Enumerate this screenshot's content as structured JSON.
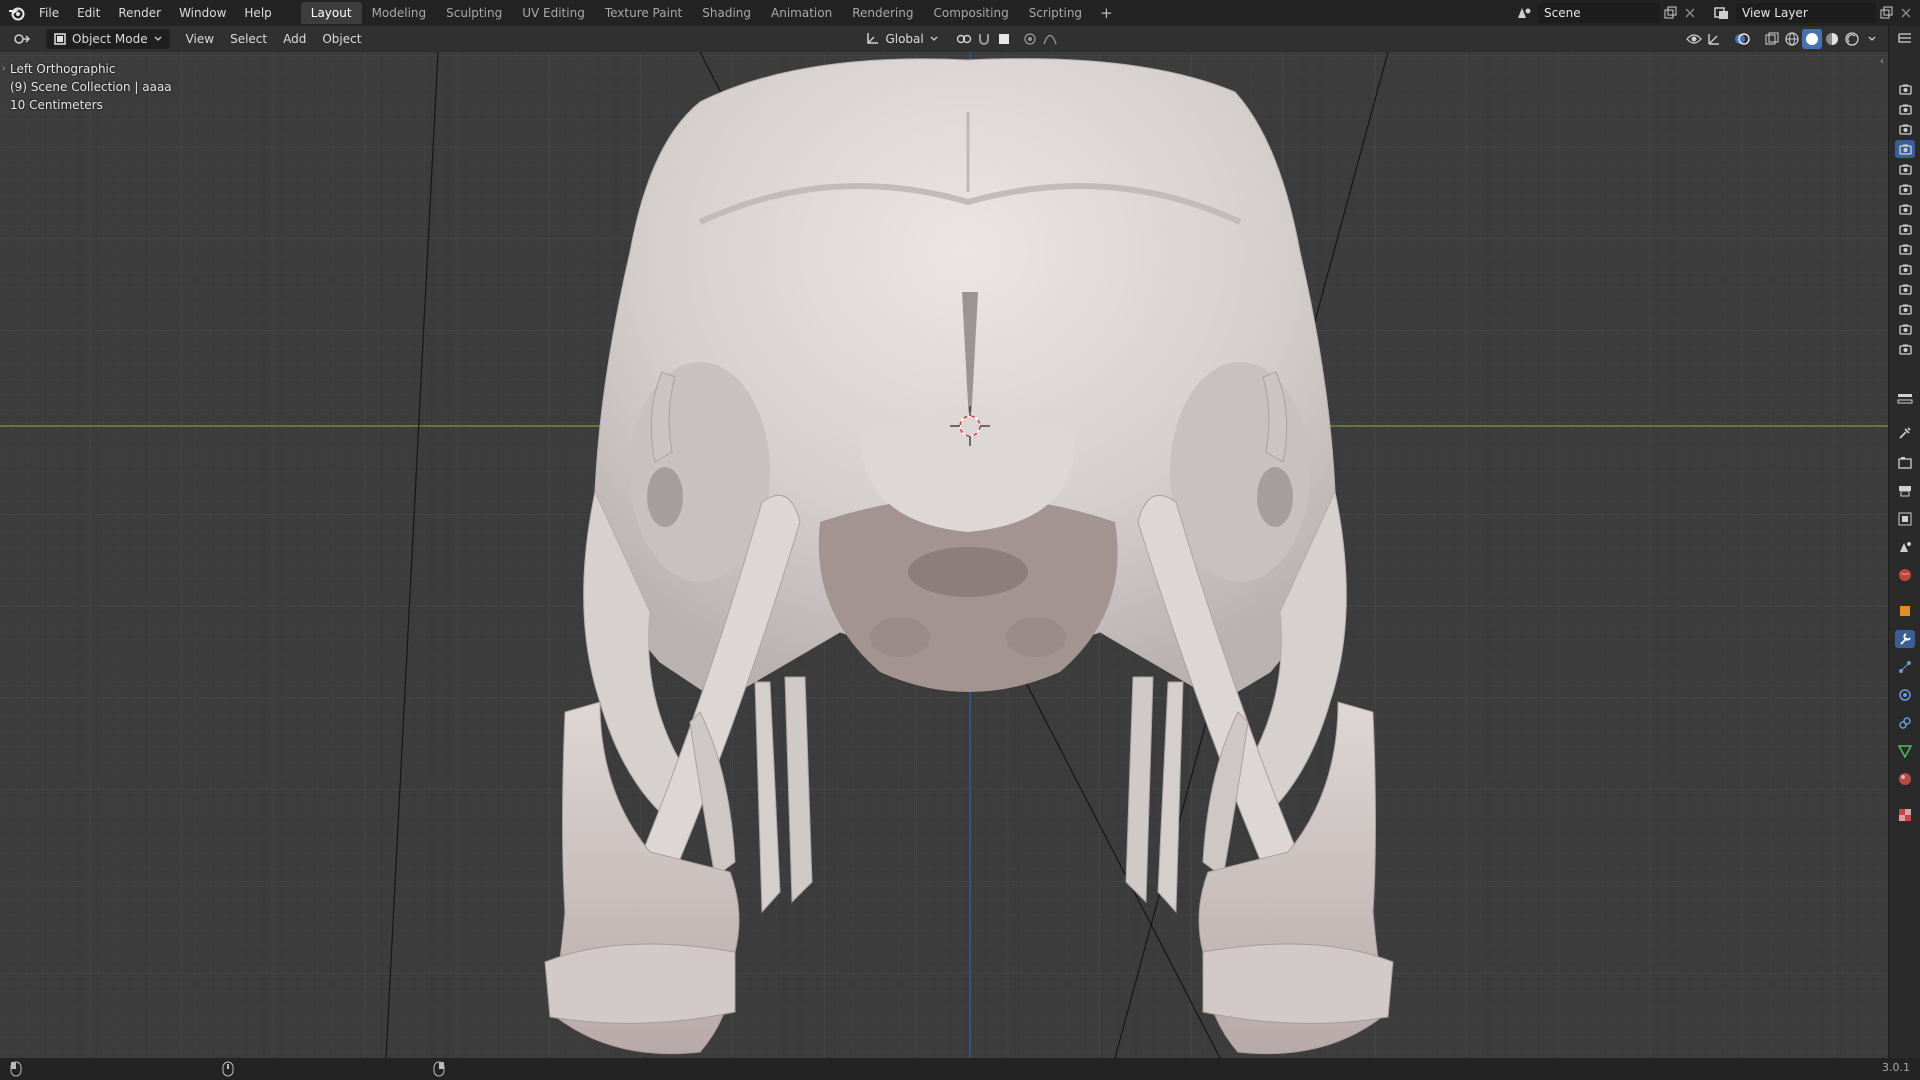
{
  "topbar": {
    "menus": [
      "File",
      "Edit",
      "Render",
      "Window",
      "Help"
    ],
    "workspaces": [
      "Layout",
      "Modeling",
      "Sculpting",
      "UV Editing",
      "Texture Paint",
      "Shading",
      "Animation",
      "Rendering",
      "Compositing",
      "Scripting"
    ],
    "active_workspace": "Layout",
    "add_tab": "+",
    "scene": "Scene",
    "view_layer": "View Layer"
  },
  "header": {
    "mode": "Object Mode",
    "menus": [
      "View",
      "Select",
      "Add",
      "Object"
    ],
    "orientation": "Global"
  },
  "viewport": {
    "view_name": "Left Orthographic",
    "collection": "(9) Scene Collection | aaaa",
    "scale": "10 Centimeters"
  },
  "statusbar": {
    "version": "3.0.1"
  },
  "colors": {
    "accent": "#4772b3",
    "x_axis": "#6a8f2a",
    "z_axis": "#2f5e9e",
    "model": "#dad4d2"
  }
}
